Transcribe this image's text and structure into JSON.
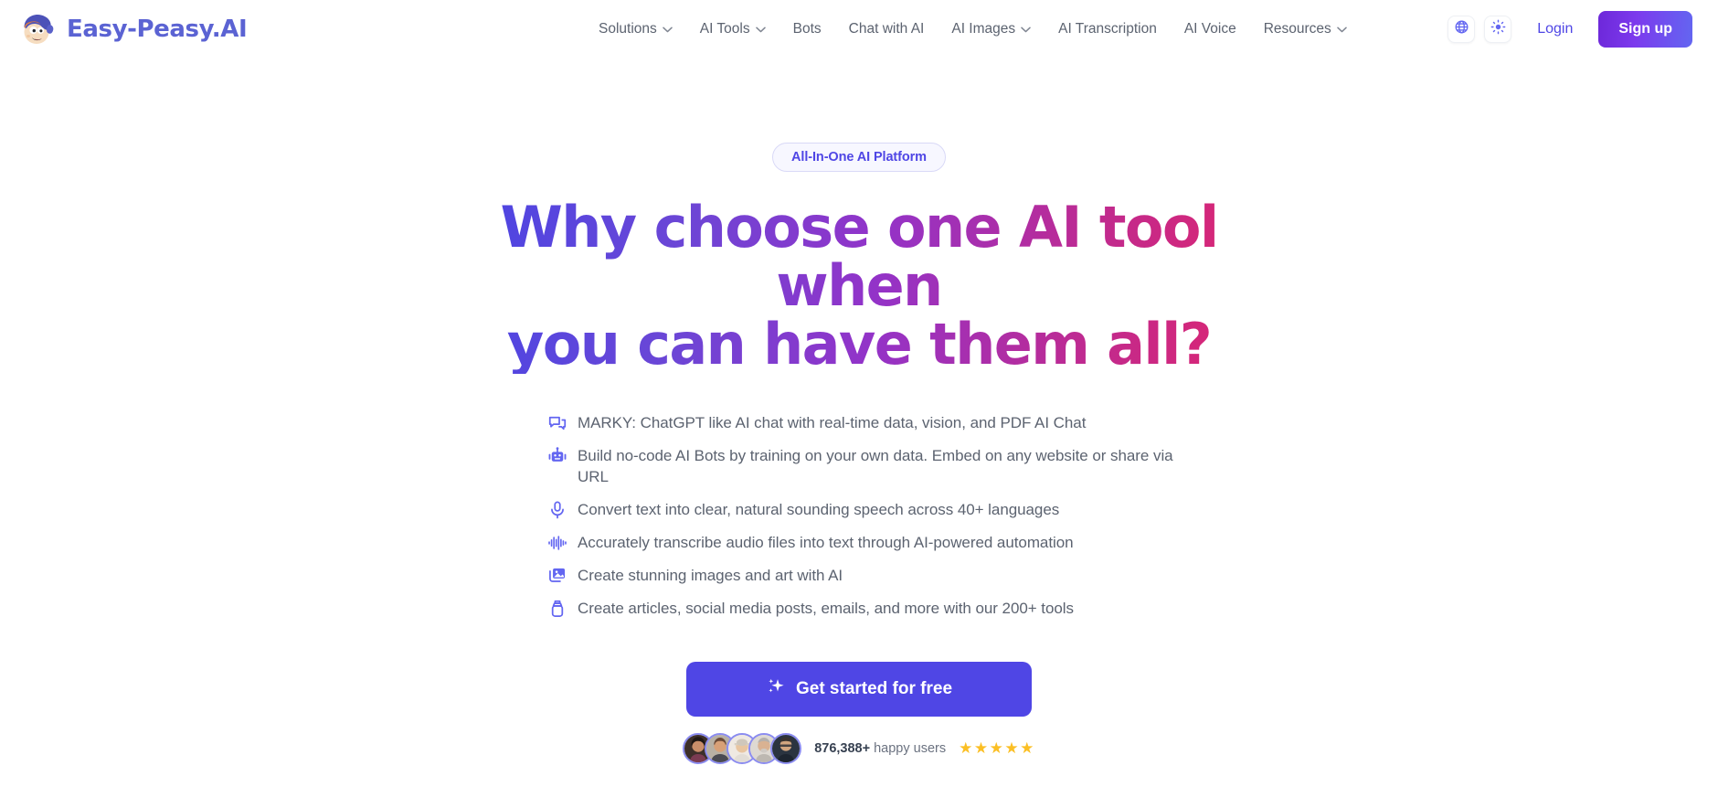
{
  "brand": {
    "name": "Easy-Peasy.AI",
    "logo_icon": "mascot-face-icon"
  },
  "nav": {
    "items": [
      {
        "label": "Solutions",
        "has_dropdown": true
      },
      {
        "label": "AI Tools",
        "has_dropdown": true
      },
      {
        "label": "Bots",
        "has_dropdown": false
      },
      {
        "label": "Chat with AI",
        "has_dropdown": false
      },
      {
        "label": "AI Images",
        "has_dropdown": true
      },
      {
        "label": "AI Transcription",
        "has_dropdown": false
      },
      {
        "label": "AI Voice",
        "has_dropdown": false
      },
      {
        "label": "Resources",
        "has_dropdown": true
      }
    ]
  },
  "header_actions": {
    "language_icon": "globe-icon",
    "theme_icon": "sun-icon",
    "login_label": "Login",
    "signup_label": "Sign up"
  },
  "hero": {
    "badge": "All-In-One AI Platform",
    "headline_line1": "Why choose one AI tool when",
    "headline_line2": "you can have them all?",
    "features": [
      {
        "icon": "chat-bubbles-icon",
        "text": "MARKY: ChatGPT like AI chat with real-time data, vision, and PDF AI Chat"
      },
      {
        "icon": "robot-icon",
        "text": "Build no-code AI Bots by training on your own data. Embed on any website or share via URL"
      },
      {
        "icon": "microphone-icon",
        "text": "Convert text into clear, natural sounding speech across 40+ languages"
      },
      {
        "icon": "audio-waveform-icon",
        "text": "Accurately transcribe audio files into text through AI-powered automation"
      },
      {
        "icon": "images-icon",
        "text": "Create stunning images and art with AI"
      },
      {
        "icon": "ink-bottle-icon",
        "text": "Create articles, social media posts, emails, and more with our 200+ tools"
      }
    ],
    "cta_label": "Get started for free",
    "cta_icon": "sparkles-icon",
    "social_proof": {
      "count": "876,388+",
      "label": "happy users",
      "stars": "★★★★★",
      "avatar_count": 5
    }
  },
  "colors": {
    "accent": "#4f46e5",
    "brand_text": "#5b63d3",
    "gradient_start": "#4845e4",
    "gradient_end": "#e0256d",
    "star": "#fbbf24",
    "body_text": "#5c6370"
  }
}
